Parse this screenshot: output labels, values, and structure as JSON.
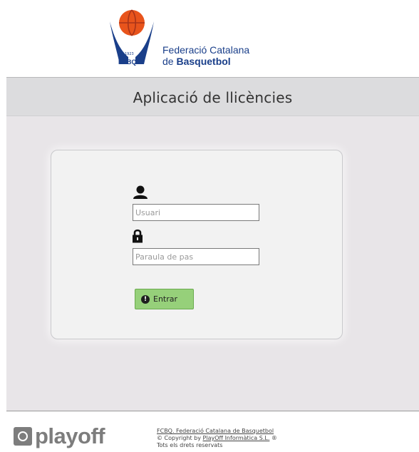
{
  "header": {
    "org_line1": "Federació Catalana",
    "org_line2_prefix": "de ",
    "org_line2_bold": "Basquetbol",
    "logo_year": "1923",
    "logo_abbrev": "FCBQ"
  },
  "title_bar": {
    "title": "Aplicació de llicències"
  },
  "login": {
    "user_placeholder": "Usuari",
    "password_placeholder": "Paraula de pas",
    "submit_label": "Entrar",
    "submit_icon": "!"
  },
  "footer": {
    "brand": "playoff",
    "link1": "FCBQ. Federació Catalana de Basquetbol",
    "copyright_prefix": "© Copyright by ",
    "link2": "PlayOff Informàtica S.L.",
    "copyright_suffix": " ®",
    "rights": "Tots els drets reservats"
  },
  "colors": {
    "brand_blue": "#1a3f8a",
    "ball_orange": "#e8541c",
    "button_green": "#96d07a"
  }
}
